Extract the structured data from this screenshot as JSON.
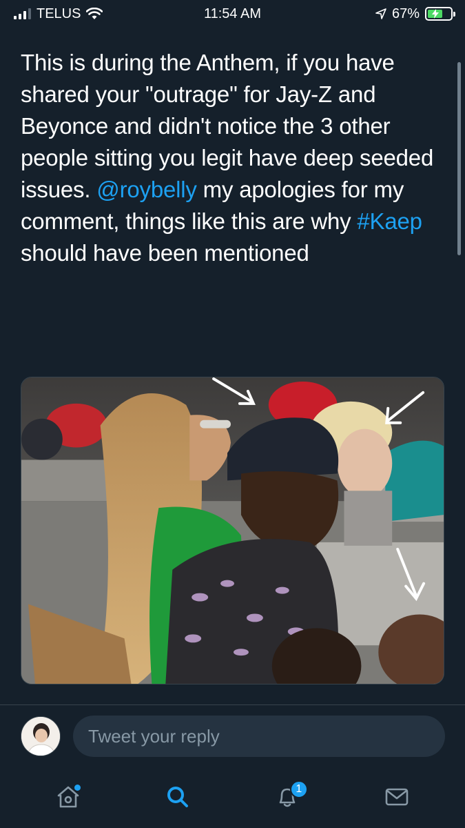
{
  "status_bar": {
    "carrier": "TELUS",
    "time": "11:54 AM",
    "battery": "67%",
    "battery_level": 0.67
  },
  "tweet": {
    "text_before_mention": "This is during the Anthem, if you have shared your \"outrage\" for Jay-Z and Beyonce and didn't notice the 3 other people sitting you legit have deep seeded issues. ",
    "mention": "@roybelly",
    "text_before_hashtag": " my apologies for my comment, things like this are why ",
    "hashtag": "#Kaep",
    "text_after_hashtag": " should have been mentioned"
  },
  "reply": {
    "placeholder": "Tweet your reply"
  },
  "tabbar": {
    "notifications_badge": "1",
    "icons": [
      "home-icon",
      "search-icon",
      "notifications-icon",
      "messages-icon"
    ]
  },
  "colors": {
    "background": "#15202b",
    "accent": "#1da1f2",
    "input_bg": "#253341",
    "muted": "#8899a6"
  }
}
